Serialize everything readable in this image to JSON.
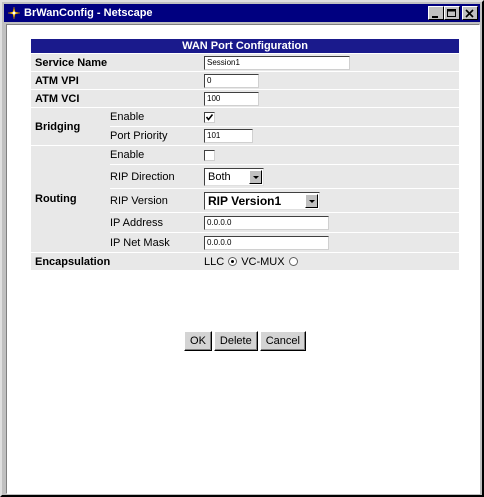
{
  "window": {
    "title": "BrWanConfig - Netscape"
  },
  "form": {
    "header": "WAN Port Configuration",
    "service_name": {
      "label": "Service Name",
      "value": "Session1"
    },
    "atm_vpi": {
      "label": "ATM VPI",
      "value": "0"
    },
    "atm_vci": {
      "label": "ATM VCI",
      "value": "100"
    },
    "bridging": {
      "label": "Bridging",
      "enable_label": "Enable",
      "enable_checked": true,
      "port_priority_label": "Port Priority",
      "port_priority_value": "101"
    },
    "routing": {
      "label": "Routing",
      "enable_label": "Enable",
      "enable_checked": false,
      "rip_direction_label": "RIP Direction",
      "rip_direction_value": "Both",
      "rip_version_label": "RIP Version",
      "rip_version_value": "RIP Version1",
      "ip_address_label": "IP Address",
      "ip_address_value": "0.0.0.0",
      "ip_net_mask_label": "IP Net Mask",
      "ip_net_mask_value": "0.0.0.0"
    },
    "encapsulation": {
      "label": "Encapsulation",
      "llc_label": "LLC",
      "vcmux_label": "VC-MUX",
      "selected": "LLC"
    }
  },
  "buttons": {
    "ok": "OK",
    "delete": "Delete",
    "cancel": "Cancel"
  },
  "icons": {
    "app": "netscape-app-icon",
    "minimize": "minimize-icon",
    "maximize": "maximize-icon",
    "close": "close-icon"
  }
}
